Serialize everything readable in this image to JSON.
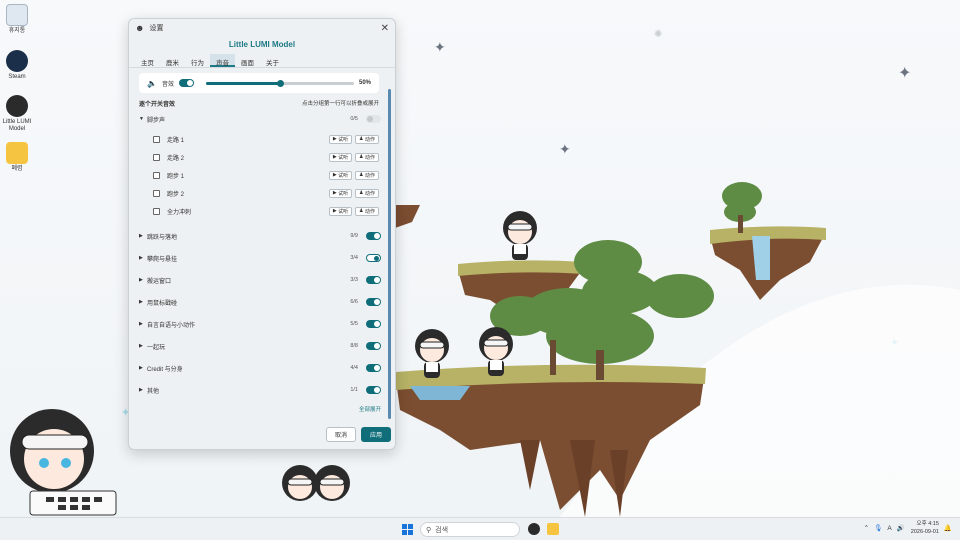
{
  "desktop": {
    "icons": [
      {
        "label": "휴지통",
        "icon": "recycle-bin-icon"
      },
      {
        "label": "Steam",
        "icon": "steam-icon"
      },
      {
        "label": "Little LUMI Model",
        "icon": "lumi-app-icon"
      },
      {
        "label": "폐렴",
        "icon": "folder-icon"
      }
    ]
  },
  "settings": {
    "window_title": "设置",
    "app_title": "Little LUMI Model",
    "tabs": [
      "主页",
      "鹿米",
      "行为",
      "声音",
      "画面",
      "关于"
    ],
    "active_tab": "声音",
    "volume": {
      "label": "音效",
      "value": 50,
      "display": "50%"
    },
    "section": {
      "title": "逐个开关音效",
      "hint": "点击分组第一行可以折叠或展开"
    },
    "groups": [
      {
        "name": "脚步声",
        "count": "0/5",
        "state": "off",
        "expanded": true,
        "items": [
          {
            "name": "走路 1",
            "listen": "试听",
            "action": "动作"
          },
          {
            "name": "走路 2",
            "listen": "试听",
            "action": "动作"
          },
          {
            "name": "跑步 1",
            "listen": "试听",
            "action": "动作"
          },
          {
            "name": "跑步 2",
            "listen": "试听",
            "action": "动作"
          },
          {
            "name": "全力冲刺",
            "listen": "试听",
            "action": "动作"
          }
        ]
      },
      {
        "name": "跳跃与落地",
        "count": "9/9",
        "state": "on"
      },
      {
        "name": "攀爬与悬挂",
        "count": "3/4",
        "state": "partial"
      },
      {
        "name": "搬运窗口",
        "count": "3/3",
        "state": "on"
      },
      {
        "name": "用鼠标戳碰",
        "count": "6/6",
        "state": "on"
      },
      {
        "name": "自言自语与小动作",
        "count": "5/5",
        "state": "on"
      },
      {
        "name": "一起玩",
        "count": "8/8",
        "state": "on"
      },
      {
        "name": "Credit 与分身",
        "count": "4/4",
        "state": "on"
      },
      {
        "name": "其他",
        "count": "1/1",
        "state": "on"
      }
    ],
    "expand_all": "全部展开",
    "cancel": "取消",
    "apply": "应用"
  },
  "taskbar": {
    "search_placeholder": "검색",
    "tray_lang": "A",
    "time": "오후 4:15",
    "date": "2026-09-01"
  },
  "colors": {
    "accent": "#0f6e79",
    "title": "#1d7a86"
  }
}
